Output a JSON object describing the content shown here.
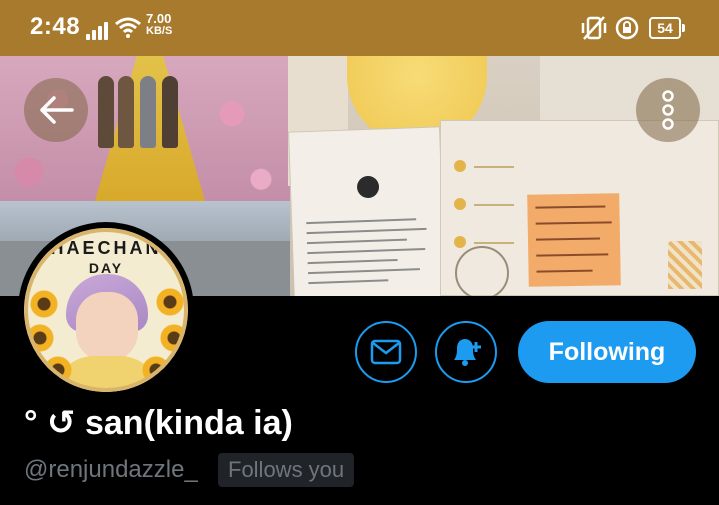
{
  "status_bar": {
    "time": "2:48",
    "net_speed_value": "7.00",
    "net_speed_unit": "KB/S",
    "battery": "54",
    "icons": [
      "signal-icon",
      "wifi-icon",
      "vibrate-icon",
      "rotation-lock-icon",
      "battery-icon"
    ],
    "background": "#a87a2d"
  },
  "header": {
    "back_icon": "arrow-left-icon",
    "more_icon": "more-vertical-icon"
  },
  "avatar": {
    "title_text": "HAECHAN",
    "subtitle_text": "DAY"
  },
  "actions": {
    "message_icon": "envelope-icon",
    "notify_icon": "bell-plus-icon",
    "following_label": "Following",
    "accent": "#1d9bf0"
  },
  "profile": {
    "display_name": "° ↺ san(kinda ia)",
    "handle": "@renjundazzle_",
    "follows_you_badge": "Follows you"
  }
}
